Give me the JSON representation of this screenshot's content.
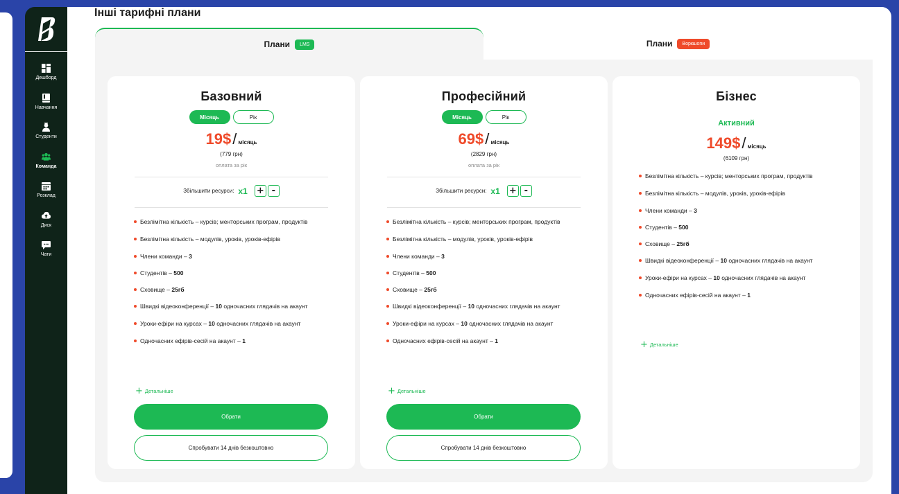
{
  "page": {
    "title": "Інші тарифні плани"
  },
  "sidebar": {
    "logo": "logo-icon",
    "items": [
      {
        "label": "Дешборд",
        "icon": "dashboard-icon"
      },
      {
        "label": "Навчання",
        "icon": "book-icon"
      },
      {
        "label": "Студенти",
        "icon": "student-icon"
      },
      {
        "label": "Команда",
        "icon": "team-icon",
        "active": true
      },
      {
        "label": "Розклад",
        "icon": "calendar-icon"
      },
      {
        "label": "Диск",
        "icon": "cloud-icon"
      },
      {
        "label": "Чати",
        "icon": "chat-icon"
      }
    ]
  },
  "tabs": [
    {
      "label": "Плани",
      "badge": "LMS",
      "badge_color": "#1db954",
      "active": true
    },
    {
      "label": "Плани",
      "badge": "Воркшопи",
      "badge_color": "#ef4a2a",
      "active": false
    }
  ],
  "plans": [
    {
      "name": "Базовний",
      "toggle": {
        "month": "Місяць",
        "year": "Рік"
      },
      "price": "19$",
      "slash": "/",
      "per": "місяць",
      "uah": "(779 грн)",
      "billed": "оплата за рік",
      "resources": {
        "label": "Збільшити ресурси:",
        "multiplier": "x1",
        "plus": "+",
        "minus": "-"
      },
      "features": [
        {
          "text": "Безлімітна кількість – курсів; менторських програм, продуктів",
          "bold": ""
        },
        {
          "text": "Безлімітна кількість – модулів, уроків, уроків-ефірів",
          "bold": ""
        },
        {
          "text": "Члени команди – ",
          "bold": "3"
        },
        {
          "text": "Студентів – ",
          "bold": "500"
        },
        {
          "text": "Сховище – ",
          "bold": "25гб"
        },
        {
          "text": "Швидкі відеоконференції – ",
          "bold": "10",
          "tail": " одночасних глядачів на акаунт"
        },
        {
          "text": "Уроки-ефіри на курсах – ",
          "bold": "10",
          "tail": " одночасних глядачів на акаунт"
        },
        {
          "text": "Одночасних ефірів-сесій на акаунт – ",
          "bold": "1"
        }
      ],
      "details": "Детальніше",
      "choose": "Обрати",
      "trial": "Спробувати 14 днів безкоштовно"
    },
    {
      "name": "Професійний",
      "toggle": {
        "month": "Місяць",
        "year": "Рік"
      },
      "price": "69$",
      "slash": "/",
      "per": "місяць",
      "uah": "(2829 грн)",
      "billed": "оплата за рік",
      "resources": {
        "label": "Збільшити ресурси:",
        "multiplier": "x1",
        "plus": "+",
        "minus": "-"
      },
      "features": [
        {
          "text": "Безлімітна кількість – курсів; менторських програм, продуктів",
          "bold": ""
        },
        {
          "text": "Безлімітна кількість – модулів, уроків, уроків-ефірів",
          "bold": ""
        },
        {
          "text": "Члени команди – ",
          "bold": "3"
        },
        {
          "text": "Студентів – ",
          "bold": "500"
        },
        {
          "text": "Сховище – ",
          "bold": "25гб"
        },
        {
          "text": "Швидкі відеоконференції – ",
          "bold": "10",
          "tail": " одночасних глядачів на акаунт"
        },
        {
          "text": "Уроки-ефіри на курсах – ",
          "bold": "10",
          "tail": " одночасних глядачів на акаунт"
        },
        {
          "text": "Одночасних ефірів-сесій на акаунт – ",
          "bold": "1"
        }
      ],
      "details": "Детальніше",
      "choose": "Обрати",
      "trial": "Спробувати 14 днів безкоштовно"
    },
    {
      "name": "Бізнес",
      "status": "Активний",
      "price": "149$",
      "slash": "/",
      "per": "місяць",
      "uah": "(6109 грн)",
      "features": [
        {
          "text": "Безлімітна кількість – курсів; менторських програм, продуктів",
          "bold": ""
        },
        {
          "text": "Безлімітна кількість – модулів, уроків, уроків-ефірів",
          "bold": ""
        },
        {
          "text": "Члени команди – ",
          "bold": "3"
        },
        {
          "text": "Студентів – ",
          "bold": "500"
        },
        {
          "text": "Сховище – ",
          "bold": "25гб"
        },
        {
          "text": "Швидкі відеоконференції – ",
          "bold": "10",
          "tail": " одночасних глядачів на акаунт"
        },
        {
          "text": "Уроки-ефіри на курсах – ",
          "bold": "10",
          "tail": " одночасних глядачів на акаунт"
        },
        {
          "text": "Одночасних ефірів-сесій на акаунт – ",
          "bold": "1"
        }
      ],
      "details": "Детальніше"
    }
  ],
  "colors": {
    "accent": "#1db954",
    "price": "#ef4a2a",
    "sidebar": "#0f2319",
    "background": "#2a44a8"
  }
}
